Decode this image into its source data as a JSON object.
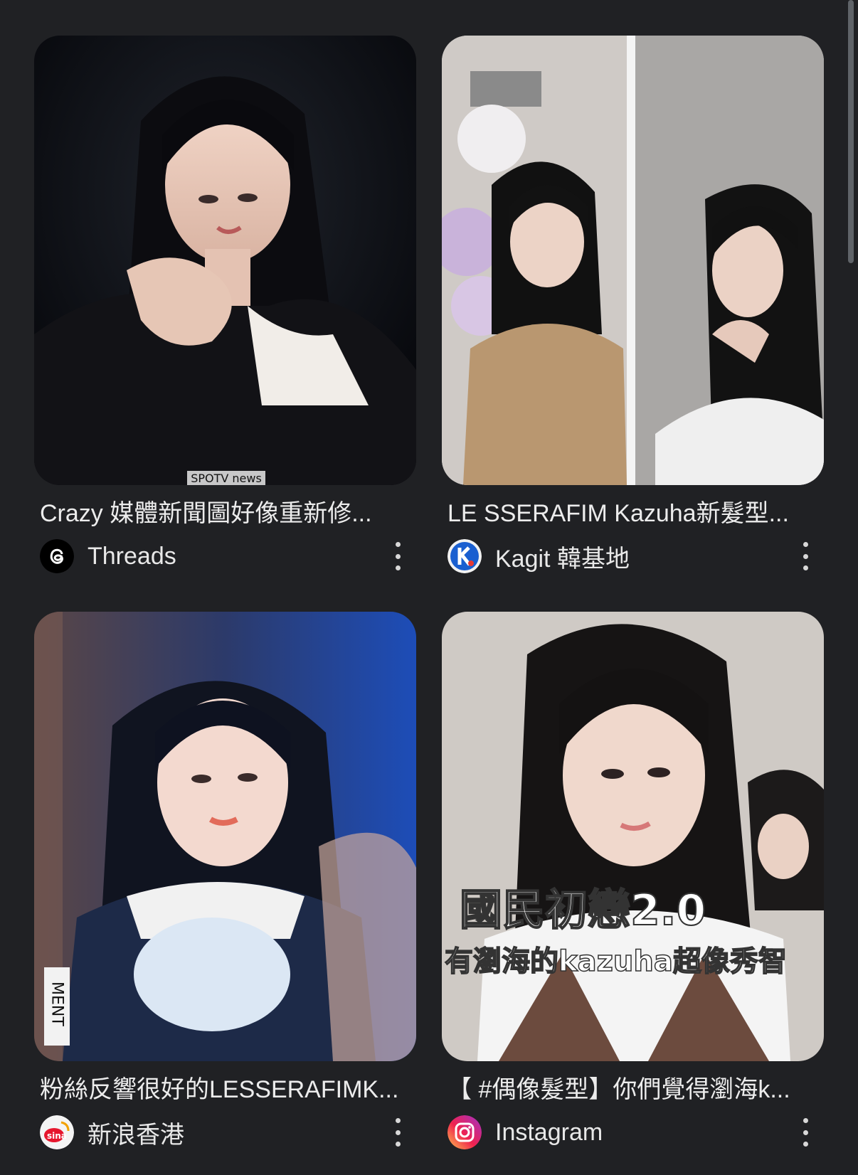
{
  "results": [
    {
      "title": "Crazy 媒體新聞圖好像重新修...",
      "source": "Threads",
      "source_icon": "threads-icon",
      "thumb_caption": "SPOTV news"
    },
    {
      "title": "LE SSERAFIM Kazuha新髮型...",
      "source": "Kagit 韓基地",
      "source_icon": "kagit-icon"
    },
    {
      "title": "粉絲反響很好的LESSERAFIMK...",
      "source": "新浪香港",
      "source_icon": "sina-icon",
      "thumb_caption": "MENT"
    },
    {
      "title": "【 #偶像髮型】你們覺得瀏海k...",
      "source": "Instagram",
      "source_icon": "instagram-icon",
      "thumb_caption_line1": "國民初戀2.0",
      "thumb_caption_line2": "有瀏海的kazuha超像秀智"
    }
  ],
  "colors": {
    "background": "#202124",
    "text": "#e8e8e8",
    "kagit_blue": "#1a73e8",
    "sina_red": "#e6162d"
  }
}
